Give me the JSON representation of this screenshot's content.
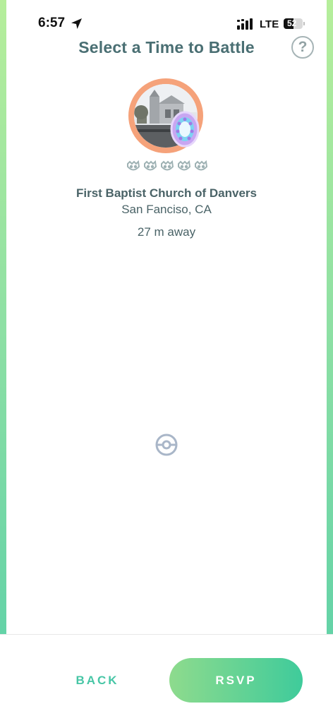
{
  "status_bar": {
    "time": "6:57",
    "network": "LTE",
    "battery": "52",
    "battery_level": 0.52
  },
  "header": {
    "title": "Select a Time to Battle",
    "help_label": "?"
  },
  "gym": {
    "name": "First Baptist Church of Danvers",
    "location": "San Fanciso, CA",
    "distance": "27 m away",
    "difficulty_icons": 5
  },
  "footer": {
    "back_label": "BACK",
    "rsvp_label": "RSVP"
  },
  "colors": {
    "title": "#4a6f73",
    "accent": "#47c6a6",
    "ring": "#f5a27a"
  }
}
